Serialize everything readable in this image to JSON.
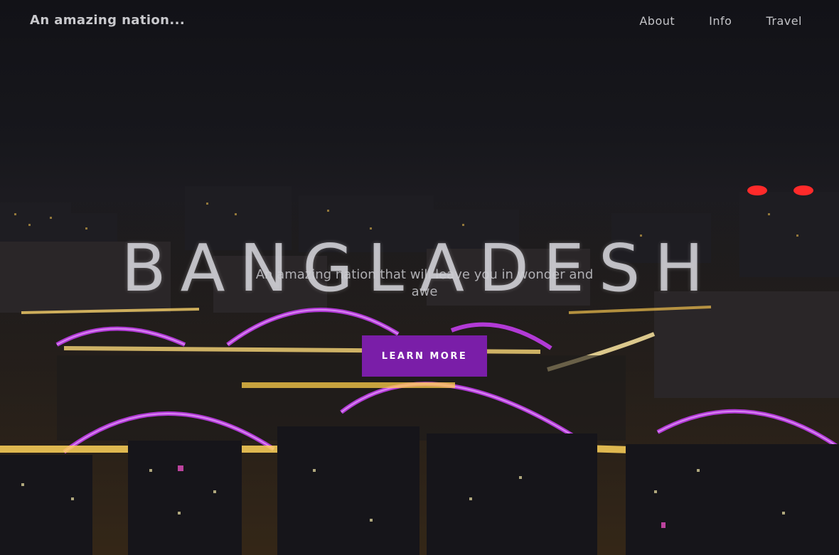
{
  "header": {
    "brand": "An amazing nation...",
    "nav": [
      {
        "label": "About"
      },
      {
        "label": "Info"
      },
      {
        "label": "Travel"
      }
    ]
  },
  "hero": {
    "title": "BANGLADESH",
    "subtitle": "An amazing nation that will leave you in wonder and awe",
    "cta_label": "LEARN MORE",
    "background": "night-city-skyline-with-illuminated-bridges"
  },
  "colors": {
    "cta": "#7a1ea8",
    "bridge_glow": "#b23ad6",
    "city_lights": "#f5c342"
  }
}
